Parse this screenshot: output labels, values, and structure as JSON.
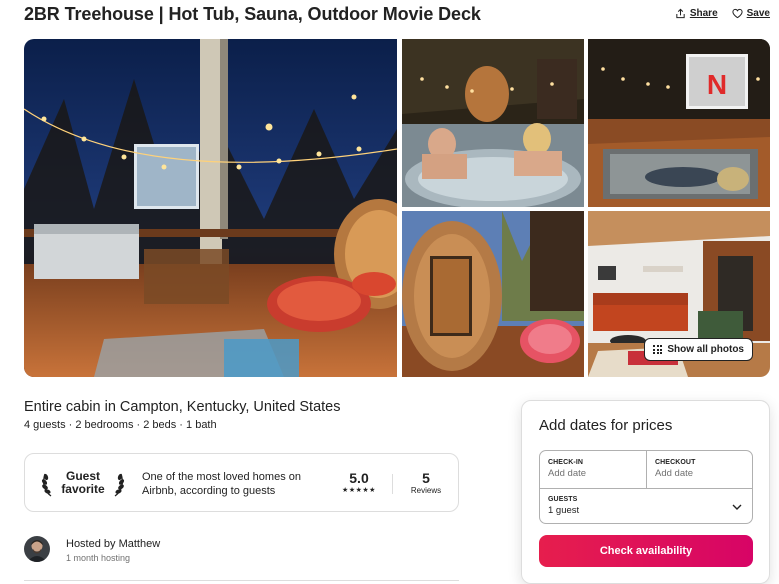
{
  "listing": {
    "title": "2BR Treehouse | Hot Tub, Sauna, Outdoor Movie Deck",
    "subtitle": "Entire cabin in Campton, Kentucky, United States",
    "details": "4 guests · 2 bedrooms · 2 beds · 1 bath"
  },
  "actions": {
    "share_label": "Share",
    "save_label": "Save"
  },
  "gallery": {
    "show_all_label": "Show all photos"
  },
  "guest_favorite": {
    "badge_line1": "Guest",
    "badge_line2": "favorite",
    "description": "One of the most loved homes on Airbnb, according to guests",
    "rating": "5.0",
    "stars": "★★★★★",
    "reviews_count": "5",
    "reviews_label": "Reviews"
  },
  "host": {
    "name": "Hosted by Matthew",
    "duration": "1 month hosting"
  },
  "booking": {
    "title": "Add dates for prices",
    "checkin_label": "CHECK-IN",
    "checkin_placeholder": "Add date",
    "checkout_label": "CHECKOUT",
    "checkout_placeholder": "Add date",
    "guests_label": "GUESTS",
    "guests_value": "1 guest",
    "cta_label": "Check availability"
  },
  "colors": {
    "brand": "#e61e4d",
    "text": "#222222",
    "muted": "#717171",
    "border": "#dddddd"
  }
}
